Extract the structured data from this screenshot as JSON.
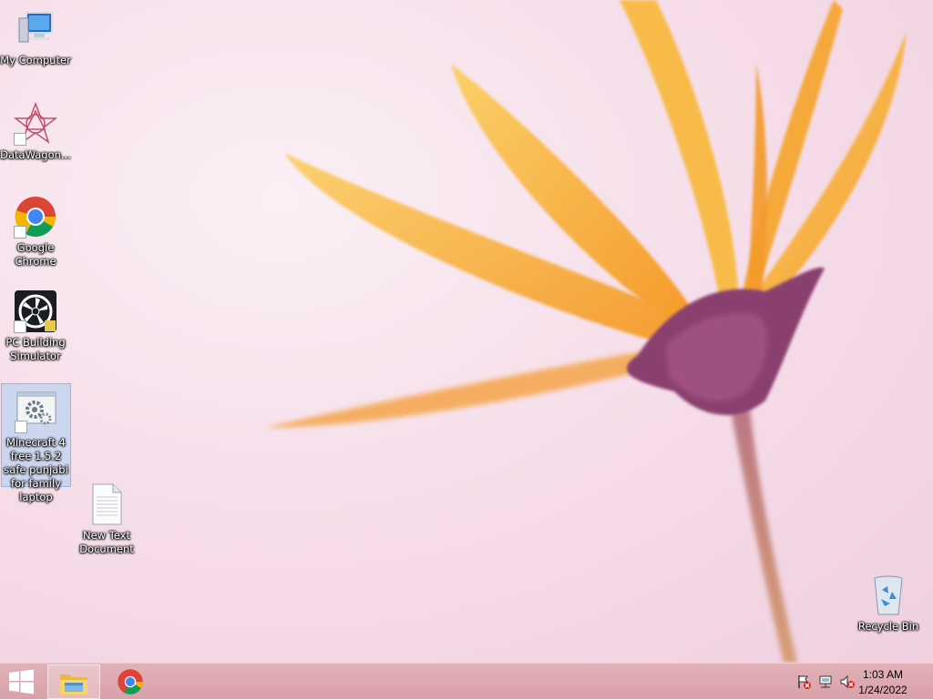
{
  "desktop": {
    "icons": [
      {
        "label": "My Computer",
        "icon": "computer-icon"
      },
      {
        "label": "DataWagon...",
        "icon": "datawagon-icon"
      },
      {
        "label": "Google Chrome",
        "icon": "chrome-icon"
      },
      {
        "label": "PC Building Simulator",
        "icon": "pc-building-simulator-icon"
      },
      {
        "label": "Minecraft 4 free 1.5.2 safe punjabi for family laptop",
        "icon": "setup-gear-icon"
      },
      {
        "label": "New Text Document",
        "icon": "text-document-icon"
      },
      {
        "label": "Recycle Bin",
        "icon": "recycle-bin-icon"
      }
    ]
  },
  "taskbar": {
    "start": "windows-start-icon",
    "pinned": [
      {
        "name": "File Explorer",
        "icon": "file-explorer-icon",
        "active": true
      },
      {
        "name": "Google Chrome",
        "icon": "chrome-icon",
        "active": false
      }
    ],
    "tray": [
      "action-center-flag-icon",
      "network-icon",
      "volume-muted-icon"
    ],
    "clock": {
      "time": "1:03 AM",
      "date": "1/24/2022"
    }
  },
  "colors": {
    "taskbar": "#d9a1a9",
    "petal": "#f7b23e",
    "wallpaper": "#f6dfea"
  }
}
